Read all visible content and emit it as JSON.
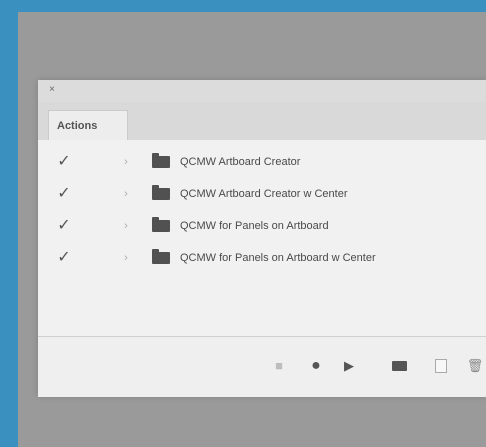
{
  "panel": {
    "close_glyph": "×",
    "tab_label": "Actions"
  },
  "actions": [
    {
      "label": "QCMW Artboard Creator"
    },
    {
      "label": "QCMW Artboard Creator w Center"
    },
    {
      "label": "QCMW for Panels on Artboard"
    },
    {
      "label": "QCMW for Panels on Artboard w Center"
    }
  ],
  "footer": {
    "stop_icon": "stop-icon",
    "record_icon": "record-icon",
    "play_icon": "play-icon",
    "new_folder_icon": "folder-icon",
    "new_action_icon": "new-action-icon",
    "delete_icon": "trash-icon"
  },
  "colors": {
    "background_blue": "#3a90bf",
    "backdrop_gray": "#9a9a9a",
    "panel_gray": "#e9e9e9",
    "folder_icon": "#515151"
  }
}
